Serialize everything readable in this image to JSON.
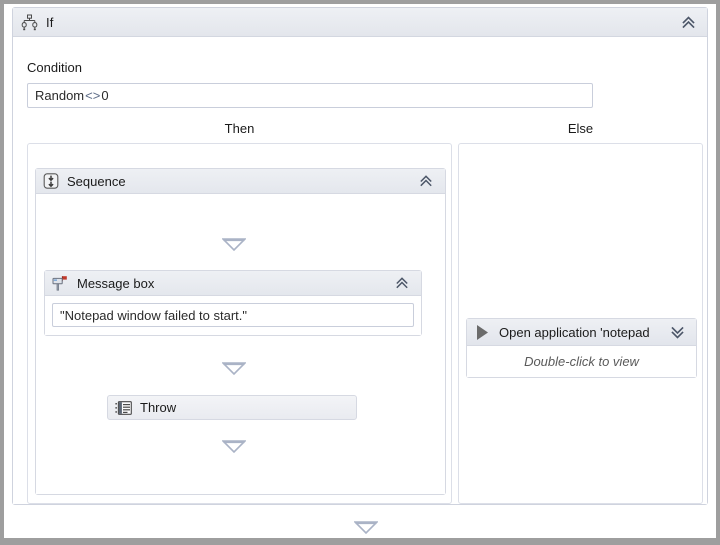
{
  "activity": {
    "title": "If",
    "icon": "if-branch-icon",
    "collapse_icon": "double-chevron-up-icon"
  },
  "condition": {
    "label": "Condition",
    "value_left": "Random",
    "value_operator": "<>",
    "value_right": "0",
    "full_value": "Random <> 0"
  },
  "branches": {
    "then_label": "Then",
    "else_label": "Else"
  },
  "then_branch": {
    "sequence": {
      "title": "Sequence",
      "icon": "sequence-icon",
      "collapse_icon": "double-chevron-up-icon",
      "drop_marker_icon": "drop-triangle-icon",
      "children": [
        {
          "type": "message-box",
          "title": "Message box",
          "icon": "mailbox-icon",
          "collapse_icon": "double-chevron-up-icon",
          "text_value": "\"Notepad window failed to start.\""
        },
        {
          "type": "throw",
          "title": "Throw",
          "icon": "throw-icon"
        }
      ]
    }
  },
  "else_branch": {
    "activity": {
      "title": "Open application 'notepad",
      "icon": "play-triangle-icon",
      "expand_icon": "double-chevron-down-icon",
      "hint": "Double-click to view"
    }
  },
  "footer": {
    "drop_marker_icon": "drop-triangle-icon"
  },
  "colors": {
    "header_gradient_top": "#eef0f4",
    "header_gradient_bottom": "#e3e6ec",
    "border": "#d6d9e2",
    "panel_border": "#dcdfe8",
    "drop_triangle": "#aab3c6",
    "text": "#1b1b1b",
    "hint_text": "#5a5a5a",
    "page_backdrop": "#9e9e9e",
    "mailbox_flag": "#c0392b"
  }
}
